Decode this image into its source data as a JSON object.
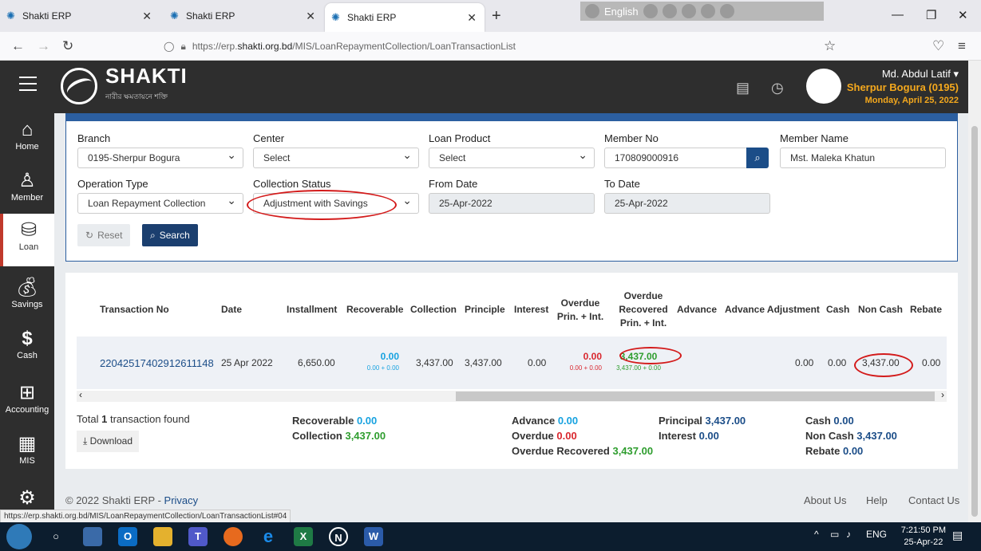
{
  "browser": {
    "tabs": [
      {
        "label": "Shakti ERP"
      },
      {
        "label": "Shakti ERP"
      },
      {
        "label": "Shakti ERP"
      }
    ],
    "language": "English",
    "url_prefix": "https://erp.",
    "url_domain": "shakti.org.bd",
    "url_path": "/MIS/LoanRepaymentCollection/LoanTransactionList"
  },
  "header": {
    "brand": "SHAKTI",
    "tagline": "নারীর ক্ষমতায়নে শক্তি",
    "user_name": "Md. Abdul Latif",
    "branch": "Sherpur Bogura (0195)",
    "date": "Monday, April 25, 2022"
  },
  "sidebar": {
    "items": [
      {
        "label": "Home",
        "icon": "home-icon"
      },
      {
        "label": "Member",
        "icon": "user-icon"
      },
      {
        "label": "Loan",
        "icon": "loan-icon"
      },
      {
        "label": "Savings",
        "icon": "money-bag-icon"
      },
      {
        "label": "Cash",
        "icon": "dollar-icon"
      },
      {
        "label": "Accounting",
        "icon": "calculator-icon"
      },
      {
        "label": "MIS",
        "icon": "report-icon"
      }
    ]
  },
  "filters": {
    "branch_label": "Branch",
    "branch_value": "0195-Sherpur Bogura",
    "center_label": "Center",
    "center_value": "Select",
    "loan_product_label": "Loan Product",
    "loan_product_value": "Select",
    "member_no_label": "Member No",
    "member_no_value": "170809000916",
    "member_name_label": "Member Name",
    "member_name_value": "Mst. Maleka Khatun",
    "operation_type_label": "Operation Type",
    "operation_type_value": "Loan Repayment Collection",
    "collection_status_label": "Collection Status",
    "collection_status_value": "Adjustment with Savings",
    "from_date_label": "From Date",
    "from_date_value": "25-Apr-2022",
    "to_date_label": "To Date",
    "to_date_value": "25-Apr-2022",
    "reset_label": "Reset",
    "search_label": "Search"
  },
  "table": {
    "headers": {
      "transaction_no": "Transaction No",
      "date": "Date",
      "installment": "Installment",
      "recoverable": "Recoverable",
      "collection": "Collection",
      "principle": "Principle",
      "interest": "Interest",
      "overdue_1": "Overdue",
      "overdue_2": "Prin. + Int.",
      "overdue_rec_1": "Overdue",
      "overdue_rec_2": "Recovered",
      "overdue_rec_3": "Prin. + Int.",
      "advance": "Advance",
      "advance_adjustment": "Advance Adjustment",
      "cash": "Cash",
      "non_cash": "Non Cash",
      "rebate": "Rebate"
    },
    "row": {
      "transaction_no": "22042517402912611148",
      "date": "25 Apr 2022",
      "installment": "6,650.00",
      "recoverable": "0.00",
      "recoverable_sub": "0.00 + 0.00",
      "collection": "3,437.00",
      "principle": "3,437.00",
      "interest": "0.00",
      "overdue": "0.00",
      "overdue_sub": "0.00 + 0.00",
      "overdue_recovered": "3,437.00",
      "overdue_recovered_sub": "3,437.00 + 0.00",
      "advance_adjustment": "0.00",
      "cash": "0.00",
      "non_cash": "3,437.00",
      "rebate": "0.00"
    }
  },
  "summary": {
    "total_prefix": "Total",
    "total_count": "1",
    "total_suffix": "transaction found",
    "download_label": "Download",
    "recoverable_label": "Recoverable",
    "recoverable_value": "0.00",
    "collection_label": "Collection",
    "collection_value": "3,437.00",
    "advance_label": "Advance",
    "advance_value": "0.00",
    "overdue_label": "Overdue",
    "overdue_value": "0.00",
    "overdue_recovered_label": "Overdue Recovered",
    "overdue_recovered_value": "3,437.00",
    "principal_label": "Principal",
    "principal_value": "3,437.00",
    "interest_label": "Interest",
    "interest_value": "0.00",
    "cash_label": "Cash",
    "cash_value": "0.00",
    "non_cash_label": "Non Cash",
    "non_cash_value": "3,437.00",
    "rebate_label": "Rebate",
    "rebate_value": "0.00"
  },
  "footer": {
    "copyright": "© 2022 Shakti ERP -",
    "privacy": "Privacy",
    "about": "About Us",
    "help": "Help",
    "contact": "Contact Us"
  },
  "status_url": "https://erp.shakti.org.bd/MIS/LoanRepaymentCollection/LoanTransactionList#04",
  "taskbar": {
    "lang": "ENG",
    "time": "7:21:50 PM",
    "date": "25-Apr-22"
  },
  "colors": {
    "header_bg": "#2e2e2e",
    "accent_blue": "#1b4d88",
    "user_branch": "#f4a81d",
    "value_blue": "#17a2e0",
    "value_red": "#d9272e",
    "value_green": "#2e9d2e",
    "annotation_red": "#d31b1b"
  }
}
